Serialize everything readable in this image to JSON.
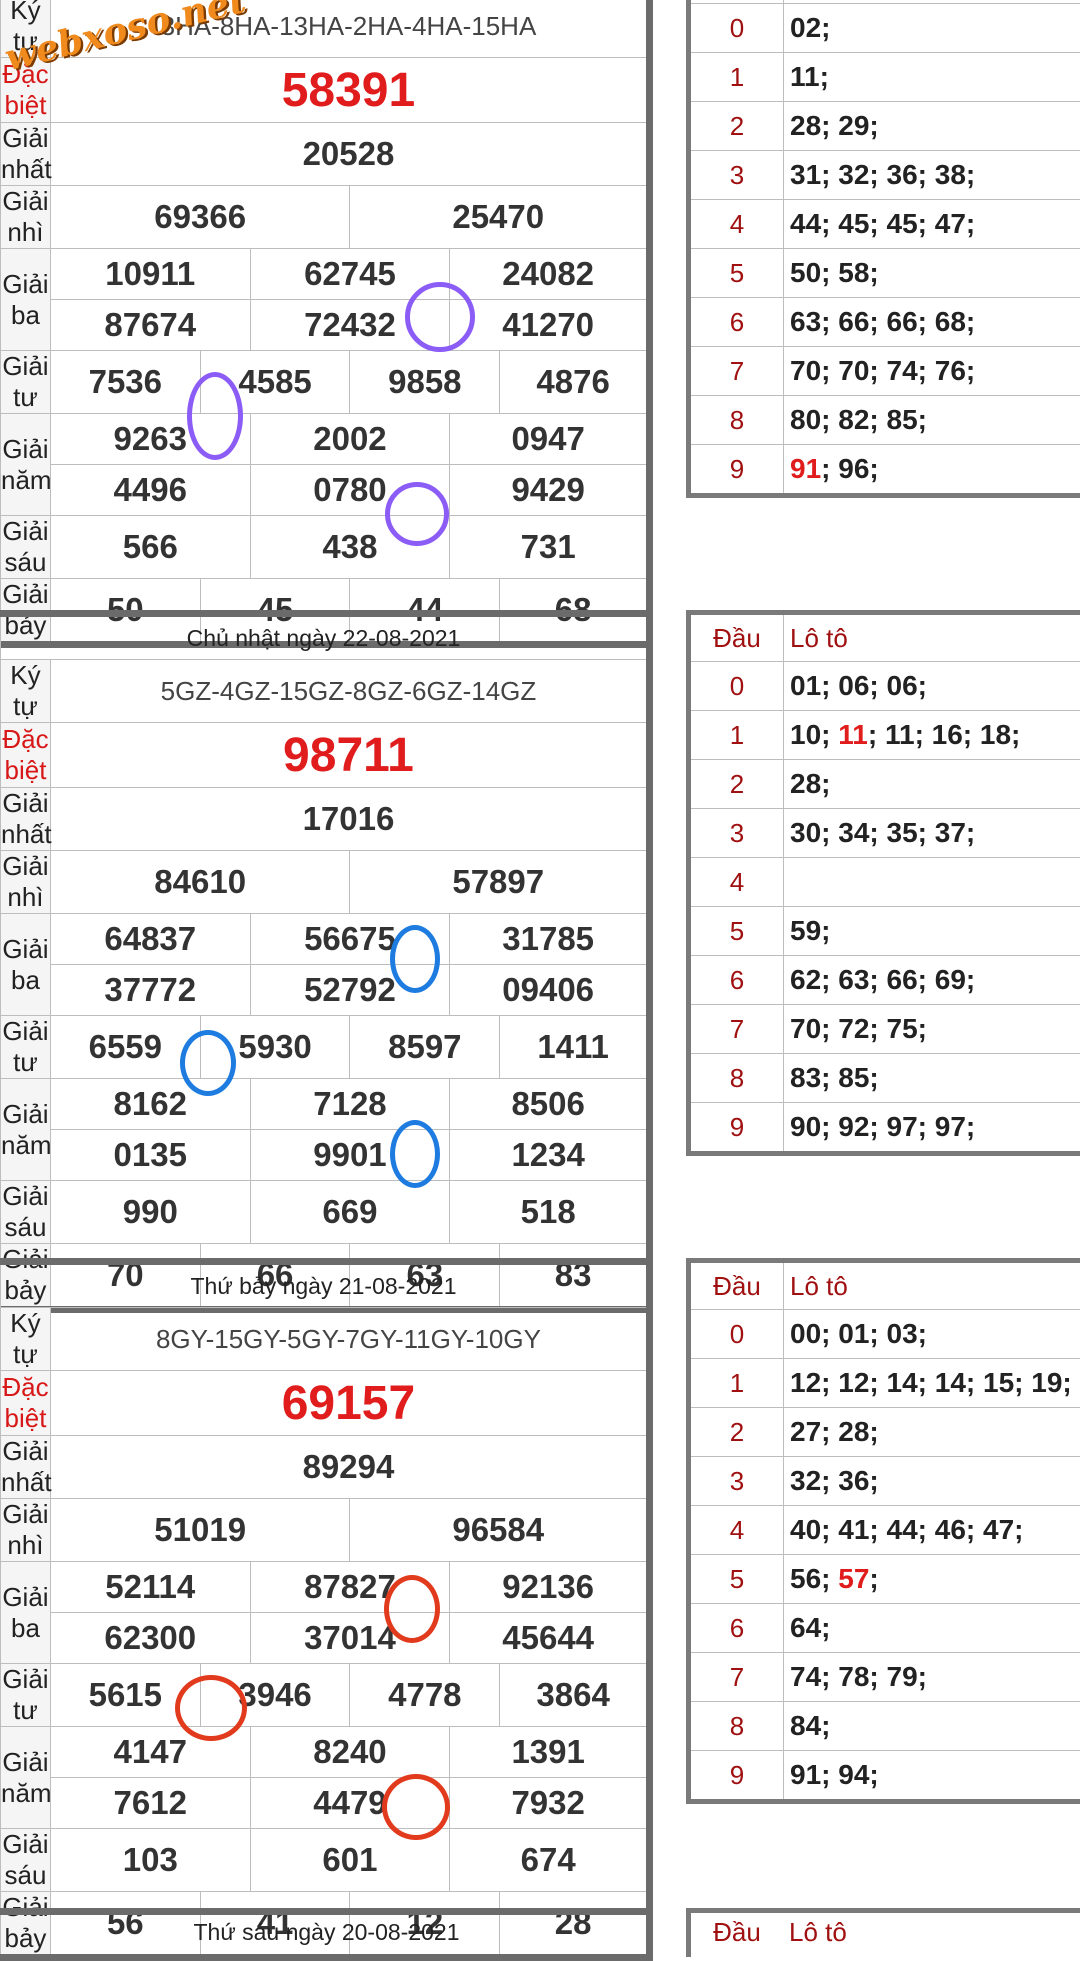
{
  "watermark": "webxoso.net",
  "labels": {
    "ky_tu": "Ký tự",
    "dac_biet": "Đặc biệt",
    "giai_nhat": "Giải nhất",
    "giai_nhi": "Giải nhì",
    "giai_ba": "Giải ba",
    "giai_tu": "Giải tư",
    "giai_nam": "Giải năm",
    "giai_sau": "Giải sáu",
    "giai_bay": "Giải bảy",
    "dau": "Đầu",
    "loto": "Lô tô"
  },
  "draws": [
    {
      "date": "",
      "ky_tu": "3HA-8HA-13HA-2HA-4HA-15HA",
      "dac_biet": "58391",
      "giai_nhat": "20528",
      "giai_nhi": [
        "69366",
        "25470"
      ],
      "giai_ba": [
        "10911",
        "62745",
        "24082",
        "87674",
        "72432",
        "41270"
      ],
      "giai_tu": [
        "7536",
        "4585",
        "9858",
        "4876"
      ],
      "giai_nam": [
        "9263",
        "2002",
        "0947",
        "4496",
        "0780",
        "9429"
      ],
      "giai_sau": [
        "566",
        "438",
        "731"
      ],
      "giai_bay": [
        "50",
        "45",
        "44",
        "68"
      ],
      "loto": [
        {
          "dau": "0",
          "so": "02;"
        },
        {
          "dau": "1",
          "so": "11;"
        },
        {
          "dau": "2",
          "so": "28; 29;"
        },
        {
          "dau": "3",
          "so": "31; 32; 36; 38;"
        },
        {
          "dau": "4",
          "so": "44; 45; 45; 47;"
        },
        {
          "dau": "5",
          "so": "50; 58;"
        },
        {
          "dau": "6",
          "so": "63; 66; 66; 68;"
        },
        {
          "dau": "7",
          "so": "70; 70; 74; 76;"
        },
        {
          "dau": "8",
          "so": "80; 82; 85;"
        },
        {
          "dau": "9",
          "so_hl": "91",
          "so": "; 96;"
        }
      ],
      "circle_color": "#8b5cf6"
    },
    {
      "date": "Chủ nhật ngày 22-08-2021",
      "ky_tu": "5GZ-4GZ-15GZ-8GZ-6GZ-14GZ",
      "dac_biet": "98711",
      "giai_nhat": "17016",
      "giai_nhi": [
        "84610",
        "57897"
      ],
      "giai_ba": [
        "64837",
        "56675",
        "31785",
        "37772",
        "52792",
        "09406"
      ],
      "giai_tu": [
        "6559",
        "5930",
        "8597",
        "1411"
      ],
      "giai_nam": [
        "8162",
        "7128",
        "8506",
        "0135",
        "9901",
        "1234"
      ],
      "giai_sau": [
        "990",
        "669",
        "518"
      ],
      "giai_bay": [
        "70",
        "66",
        "63",
        "83"
      ],
      "loto": [
        {
          "dau": "0",
          "so": "01; 06; 06;"
        },
        {
          "dau": "1",
          "so_pre": "10; ",
          "so_hl": "11",
          "so": "; 11; 16; 18;"
        },
        {
          "dau": "2",
          "so": "28;"
        },
        {
          "dau": "3",
          "so": "30; 34; 35; 37;"
        },
        {
          "dau": "4",
          "so": ""
        },
        {
          "dau": "5",
          "so": "59;"
        },
        {
          "dau": "6",
          "so": "62; 63; 66; 69;"
        },
        {
          "dau": "7",
          "so": "70; 72; 75;"
        },
        {
          "dau": "8",
          "so": "83; 85;"
        },
        {
          "dau": "9",
          "so": "90; 92; 97; 97;"
        }
      ],
      "circle_color": "#1e7be0"
    },
    {
      "date": "Thứ bảy ngày 21-08-2021",
      "ky_tu": "8GY-15GY-5GY-7GY-11GY-10GY",
      "dac_biet": "69157",
      "giai_nhat": "89294",
      "giai_nhi": [
        "51019",
        "96584"
      ],
      "giai_ba": [
        "52114",
        "87827",
        "92136",
        "62300",
        "37014",
        "45644"
      ],
      "giai_tu": [
        "5615",
        "3946",
        "4778",
        "3864"
      ],
      "giai_nam": [
        "4147",
        "8240",
        "1391",
        "7612",
        "4479",
        "7932"
      ],
      "giai_sau": [
        "103",
        "601",
        "674"
      ],
      "giai_bay": [
        "56",
        "41",
        "12",
        "28"
      ],
      "loto": [
        {
          "dau": "0",
          "so": "00; 01; 03;"
        },
        {
          "dau": "1",
          "so": "12; 12; 14; 14; 15; 19;"
        },
        {
          "dau": "2",
          "so": "27; 28;"
        },
        {
          "dau": "3",
          "so": "32; 36;"
        },
        {
          "dau": "4",
          "so": "40; 41; 44; 46; 47;"
        },
        {
          "dau": "5",
          "so_pre": "56; ",
          "so_hl": "57",
          "so": ";"
        },
        {
          "dau": "6",
          "so": "64;"
        },
        {
          "dau": "7",
          "so": "74; 78; 79;"
        },
        {
          "dau": "8",
          "so": "84;"
        },
        {
          "dau": "9",
          "so": "91; 94;"
        }
      ],
      "circle_color": "#e23a1c"
    }
  ],
  "next_date": "Thứ sáu ngày 20-08-2021"
}
